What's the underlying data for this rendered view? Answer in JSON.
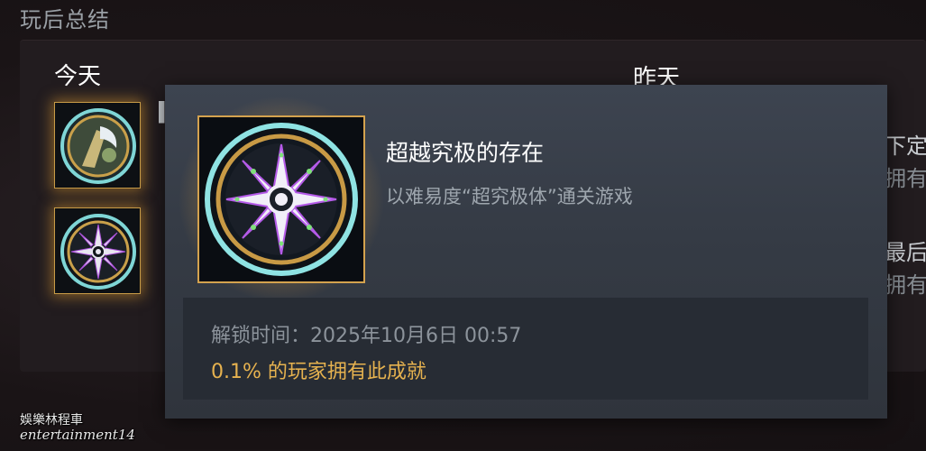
{
  "section": {
    "title": "玩后总结"
  },
  "columns": {
    "today": "今天",
    "yesterday": "昨天"
  },
  "glimpses": {
    "right": [
      "下定决",
      "拥有此",
      "最后一",
      "拥有此"
    ]
  },
  "tooltip": {
    "title": "超越究极的存在",
    "description": "以难易度“超究极体”通关游戏",
    "unlock_time": "解锁时间：2025年10月6日 00:57",
    "rarity": "0.1% 的玩家拥有此成就",
    "icon": "star-compass-achievement-icon"
  },
  "watermark": {
    "line1": "娛樂林程車",
    "line2": "entertainment14"
  },
  "colors": {
    "rarity": "#e6b24f",
    "glow": "#f0aa3c",
    "tooltip_bg": "#3d4450"
  }
}
